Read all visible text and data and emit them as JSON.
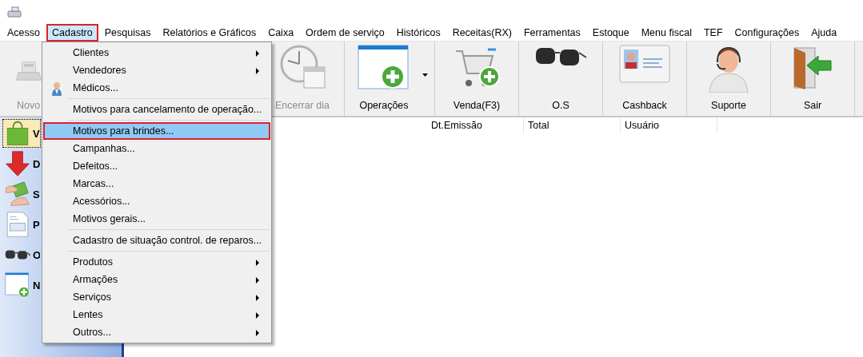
{
  "menubar": [
    {
      "label": "Acesso",
      "selected": false
    },
    {
      "label": "Cadastro",
      "selected": true
    },
    {
      "label": "Pesquisas",
      "selected": false
    },
    {
      "label": "Relatórios e Gráficos",
      "selected": false
    },
    {
      "label": "Caixa",
      "selected": false
    },
    {
      "label": "Ordem de serviço",
      "selected": false
    },
    {
      "label": "Históricos",
      "selected": false
    },
    {
      "label": "Receitas(RX)",
      "selected": false
    },
    {
      "label": "Ferramentas",
      "selected": false
    },
    {
      "label": "Estoque",
      "selected": false
    },
    {
      "label": "Menu fiscal",
      "selected": false
    },
    {
      "label": "TEF",
      "selected": false
    },
    {
      "label": "Configurações",
      "selected": false
    },
    {
      "label": "Ajuda",
      "selected": false
    }
  ],
  "toolbar": [
    {
      "label": "Novo",
      "kind": "register",
      "disabled": true
    },
    {
      "label": "Encerrar dia",
      "kind": "clock",
      "disabled": true
    },
    {
      "label": "Operações",
      "kind": "window",
      "disabled": false,
      "dropdown": true
    },
    {
      "label": "Venda(F3)",
      "kind": "cart",
      "disabled": false
    },
    {
      "label": "O.S",
      "kind": "glasses",
      "disabled": false
    },
    {
      "label": "Cashback",
      "kind": "card",
      "disabled": false
    },
    {
      "label": "Suporte",
      "kind": "support",
      "disabled": false
    },
    {
      "label": "Sair",
      "kind": "exit",
      "disabled": false
    }
  ],
  "sidebar": [
    {
      "label": "V",
      "kind": "bag",
      "selected": true
    },
    {
      "label": "D",
      "kind": "arrow",
      "selected": false
    },
    {
      "label": "S",
      "kind": "money",
      "selected": false
    },
    {
      "label": "P",
      "kind": "document",
      "selected": false
    },
    {
      "label": "O",
      "kind": "glasses",
      "selected": false
    },
    {
      "label": "N",
      "kind": "window",
      "selected": false
    }
  ],
  "table": {
    "columns": [
      "Dt.Emissão",
      "Total",
      "Usuário"
    ]
  },
  "menu": {
    "items": [
      {
        "kind": "submenu",
        "label": "Clientes",
        "selected": false
      },
      {
        "kind": "submenu",
        "label": "Vendedores",
        "selected": false
      },
      {
        "kind": "icon",
        "label": "Médicos...",
        "selected": false
      },
      {
        "kind": "separator"
      },
      {
        "kind": "plain",
        "label": "Motivos para cancelamento de operação...",
        "selected": false
      },
      {
        "kind": "separator"
      },
      {
        "kind": "plain",
        "label": "Motivos para brindes...",
        "selected": true
      },
      {
        "kind": "plain",
        "label": "Campanhas...",
        "selected": false
      },
      {
        "kind": "plain",
        "label": "Defeitos...",
        "selected": false
      },
      {
        "kind": "plain",
        "label": "Marcas...",
        "selected": false
      },
      {
        "kind": "plain",
        "label": "Acessórios...",
        "selected": false
      },
      {
        "kind": "plain",
        "label": "Motivos gerais...",
        "selected": false
      },
      {
        "kind": "separator"
      },
      {
        "kind": "plain",
        "label": "Cadastro de situação control. de reparos...",
        "selected": false
      },
      {
        "kind": "separator"
      },
      {
        "kind": "submenu",
        "label": "Produtos",
        "selected": false
      },
      {
        "kind": "submenu",
        "label": "Armações",
        "selected": false
      },
      {
        "kind": "submenu",
        "label": "Serviços",
        "selected": false
      },
      {
        "kind": "submenu",
        "label": "Lentes",
        "selected": false
      },
      {
        "kind": "submenu",
        "label": "Outros...",
        "selected": false
      }
    ]
  }
}
